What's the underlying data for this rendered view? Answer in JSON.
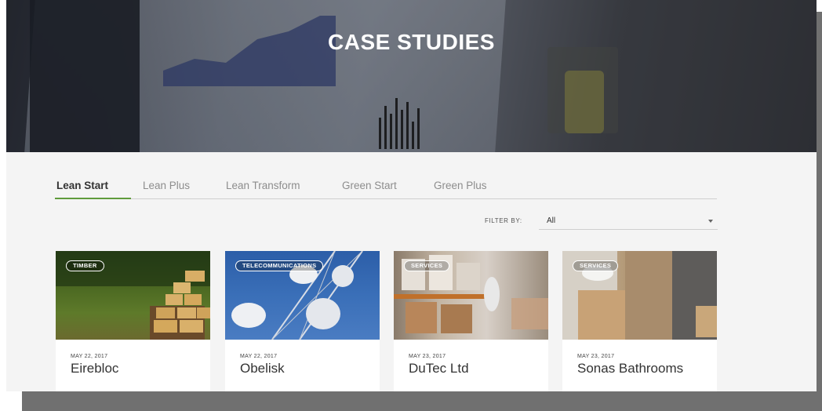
{
  "hero": {
    "title": "CASE STUDIES"
  },
  "tabs": [
    {
      "label": "Lean Start",
      "active": true
    },
    {
      "label": "Lean Plus",
      "active": false
    },
    {
      "label": "Lean Transform",
      "active": false
    },
    {
      "label": "Green Start",
      "active": false
    },
    {
      "label": "Green Plus",
      "active": false
    }
  ],
  "filter": {
    "label": "FILTER BY:",
    "value": "All"
  },
  "colors": {
    "accent": "#5f9b3c",
    "text": "#333333",
    "muted": "#8d8d8d"
  },
  "cards": [
    {
      "tag": "TIMBER",
      "date": "MAY 22, 2017",
      "title": "Eirebloc"
    },
    {
      "tag": "TELECOMMUNICATIONS",
      "date": "MAY 22, 2017",
      "title": "Obelisk"
    },
    {
      "tag": "SERVICES",
      "date": "MAY 23, 2017",
      "title": "DuTec Ltd"
    },
    {
      "tag": "SERVICES",
      "date": "MAY 23, 2017",
      "title": "Sonas Bathrooms"
    }
  ]
}
